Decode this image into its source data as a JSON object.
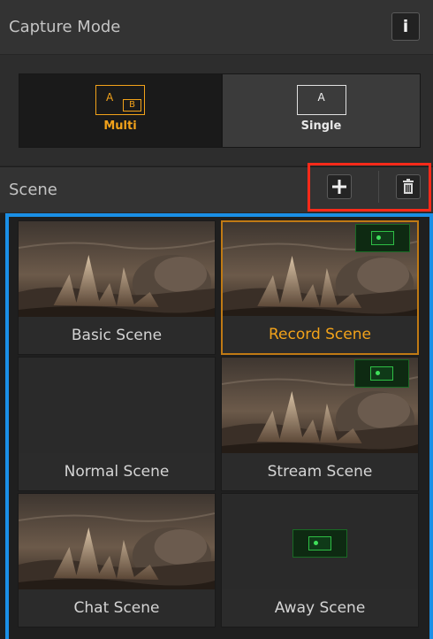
{
  "capture": {
    "title": "Capture Mode",
    "info_icon": "info-icon",
    "info_glyph": "i",
    "modes": [
      {
        "label": "Multi",
        "icon": "multi-view-icon",
        "letter_a": "A",
        "letter_b": "B",
        "selected": true
      },
      {
        "label": "Single",
        "icon": "single-view-icon",
        "letter_a": "A",
        "selected": false
      }
    ]
  },
  "scene": {
    "title": "Scene",
    "add_icon": "plus-icon",
    "delete_icon": "trash-icon",
    "tiles": [
      {
        "label": "Basic Scene",
        "thumbnail": "spiky-landscape",
        "overlay": false,
        "selected": false
      },
      {
        "label": "Record Scene",
        "thumbnail": "spiky-landscape",
        "overlay": true,
        "selected": true
      },
      {
        "label": "Normal Scene",
        "thumbnail": "empty",
        "overlay": false,
        "selected": false
      },
      {
        "label": "Stream Scene",
        "thumbnail": "spiky-landscape",
        "overlay": true,
        "selected": false
      },
      {
        "label": "Chat Scene",
        "thumbnail": "spiky-landscape",
        "overlay": false,
        "selected": false
      },
      {
        "label": "Away Scene",
        "thumbnail": "empty",
        "overlay": true,
        "selected": false
      }
    ]
  },
  "colors": {
    "accent_orange": "#f2a21a",
    "highlight_red": "#ff2a1a",
    "highlight_blue": "#1a8fe6",
    "overlay_green": "#2fbf45"
  }
}
